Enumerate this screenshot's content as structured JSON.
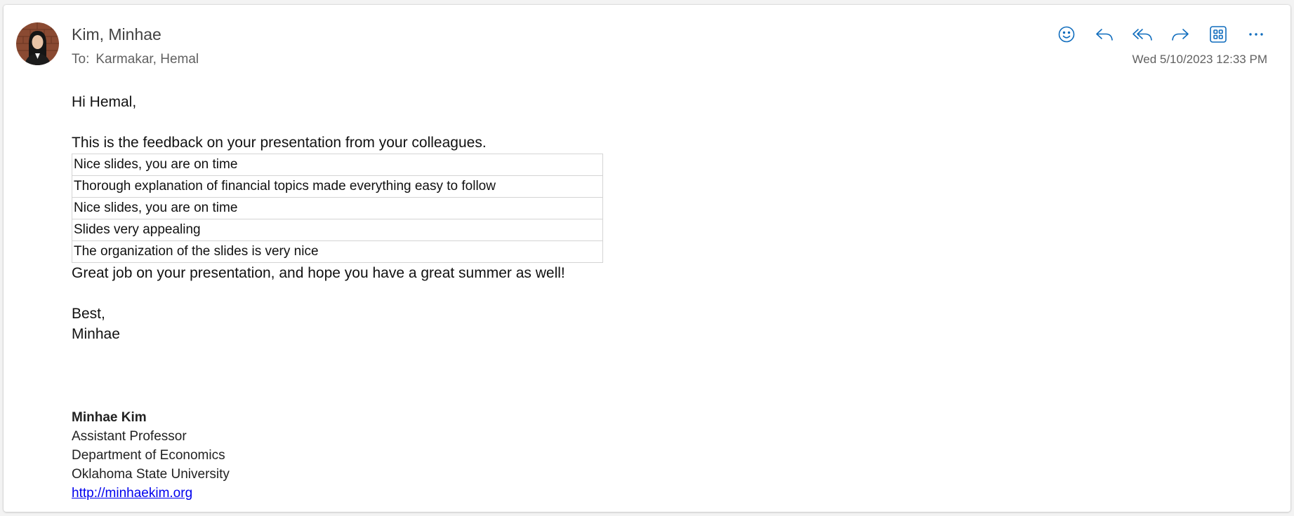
{
  "message": {
    "sender_name": "Kim, Minhae",
    "to_label": "To:",
    "recipient": "Karmakar, Hemal",
    "timestamp": "Wed 5/10/2023 12:33 PM",
    "avatar": "sender-avatar-photo"
  },
  "toolbar": {
    "icons": [
      "smiley-icon",
      "reply-icon",
      "reply-all-icon",
      "forward-icon",
      "apps-icon",
      "more-icon"
    ],
    "accent_color": "#0f6cbd"
  },
  "body": {
    "greeting": "Hi Hemal,",
    "intro": "This is the feedback on your presentation from your colleagues.",
    "feedback": [
      "Nice slides, you are on time",
      "Thorough explanation of financial topics made everything easy to follow",
      "Nice slides, you are on time",
      "Slides very appealing",
      "The organization of the slides is very nice"
    ],
    "closing_line": "Great job on your presentation, and hope you have a great summer as well!",
    "sign_off": "Best,",
    "sign_name": "Minhae"
  },
  "signature": {
    "name": "Minhae Kim",
    "title": "Assistant Professor",
    "department": "Department of Economics",
    "university": "Oklahoma State University",
    "link": "http://minhaekim.org"
  }
}
